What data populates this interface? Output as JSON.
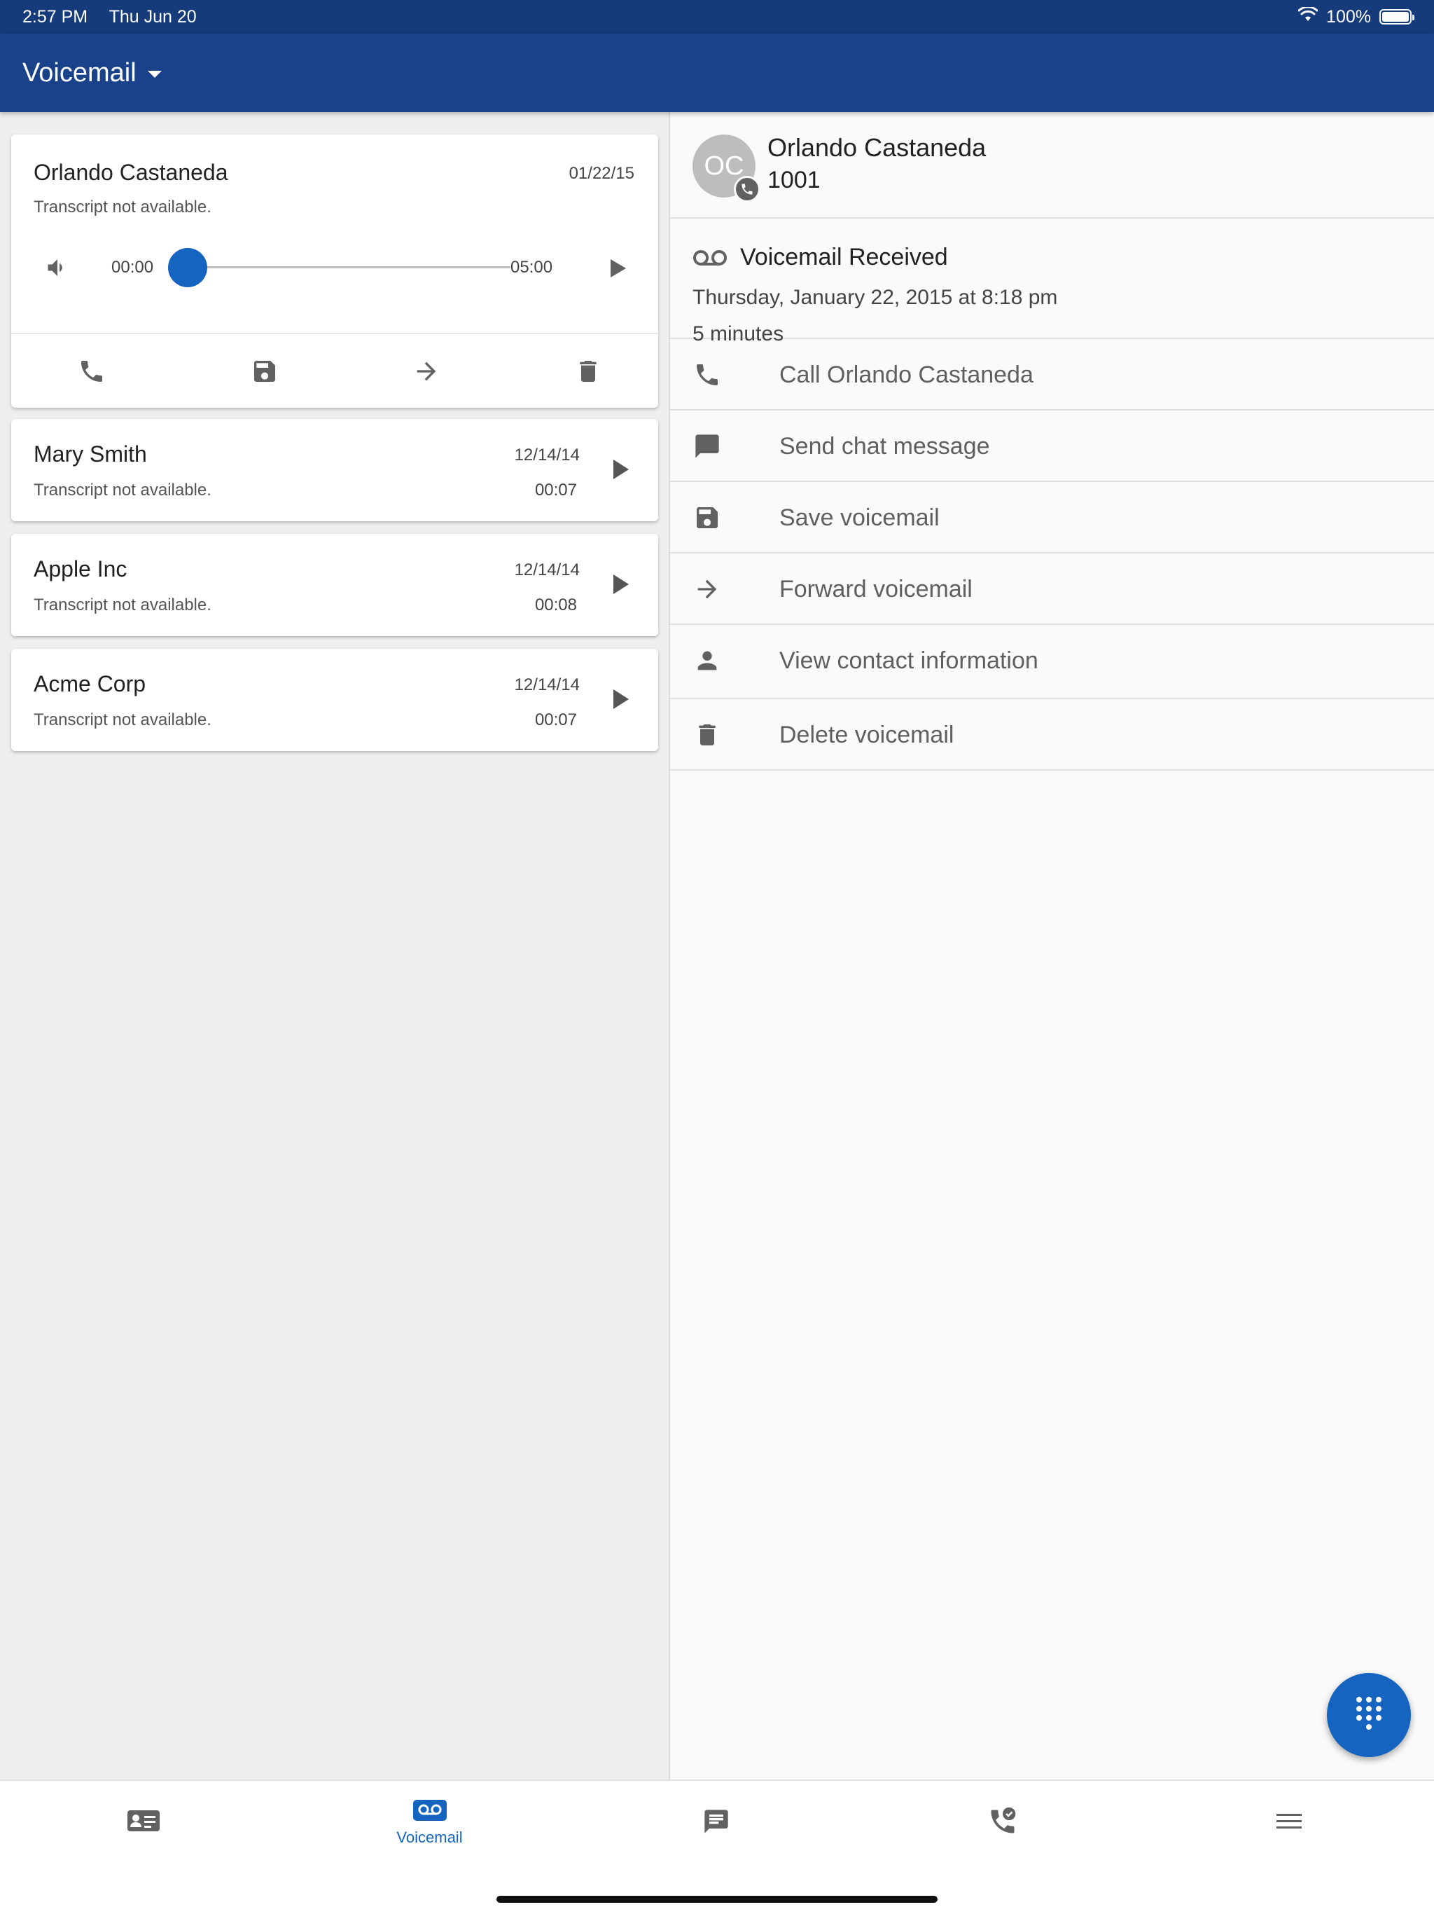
{
  "status_bar": {
    "time": "2:57 PM",
    "date": "Thu Jun 20",
    "battery": "100%"
  },
  "app_bar": {
    "title": "Voicemail"
  },
  "voicemails": [
    {
      "name": "Orlando Castaneda",
      "date": "01/22/15",
      "transcript": "Transcript not available.",
      "current": "00:00",
      "total": "05:00"
    },
    {
      "name": "Mary Smith",
      "date": "12/14/14",
      "transcript": "Transcript not available.",
      "duration": "00:07"
    },
    {
      "name": "Apple Inc",
      "date": "12/14/14",
      "transcript": "Transcript not available.",
      "duration": "00:08"
    },
    {
      "name": "Acme Corp",
      "date": "12/14/14",
      "transcript": "Transcript not available.",
      "duration": "00:07"
    }
  ],
  "detail": {
    "initials": "OC",
    "name": "Orlando Castaneda",
    "extension": "1001",
    "vm_title": "Voicemail Received",
    "vm_datetime": "Thursday, January 22, 2015 at 8:18 pm",
    "vm_length": "5 minutes",
    "actions": [
      {
        "label": "Call Orlando Castaneda",
        "icon": "phone-icon"
      },
      {
        "label": "Send chat message",
        "icon": "chat-icon"
      },
      {
        "label": "Save voicemail",
        "icon": "save-icon"
      },
      {
        "label": "Forward voicemail",
        "icon": "forward-arrow-icon"
      },
      {
        "label": "View contact information",
        "icon": "person-icon"
      },
      {
        "label": "Delete voicemail",
        "icon": "trash-icon"
      }
    ]
  },
  "bottom_nav": {
    "items": [
      {
        "icon": "contacts-card-icon",
        "label": ""
      },
      {
        "icon": "voicemail-icon",
        "label": "Voicemail"
      },
      {
        "icon": "chat-icon",
        "label": ""
      },
      {
        "icon": "call-history-icon",
        "label": ""
      },
      {
        "icon": "menu-icon",
        "label": ""
      }
    ]
  },
  "colors": {
    "header": "#1a428a",
    "status_bar": "#153b7a",
    "accent": "#1565c0",
    "icon_gray": "#616161"
  }
}
